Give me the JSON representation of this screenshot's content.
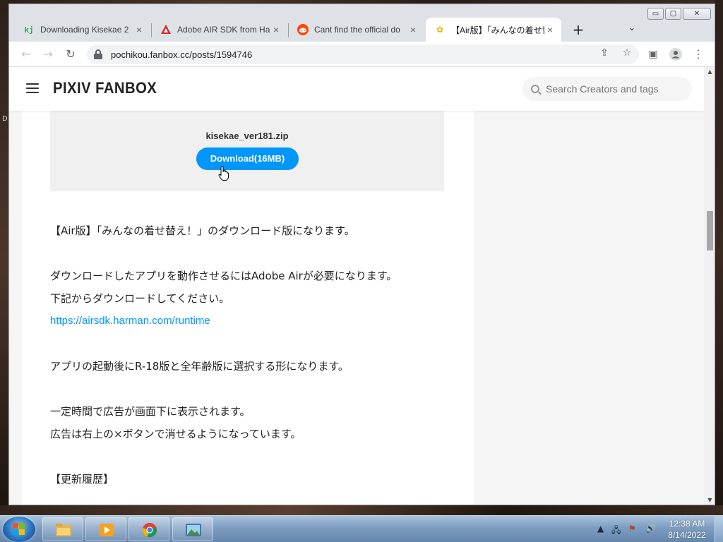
{
  "desktop": {
    "edge_char": "D"
  },
  "browser": {
    "tabs": [
      {
        "title": "Downloading Kisekae 2",
        "favicon": "kisekae-favicon",
        "color": "#3aa757"
      },
      {
        "title": "Adobe AIR SDK from Ha",
        "favicon": "adobe-air-favicon",
        "color": "#cc2b2b"
      },
      {
        "title": "Cant find the official do",
        "favicon": "reddit-favicon",
        "color": "#ff4500"
      },
      {
        "title": "【Air版】「みんなの着せ替え",
        "favicon": "fanbox-favicon",
        "color": "#f0b400",
        "active": true
      }
    ],
    "new_tab_symbol": "+",
    "url": "pochikou.fanbox.cc/posts/1594746",
    "window_controls": {
      "minimize": "▭",
      "maximize": "▢",
      "close": "✕"
    }
  },
  "site": {
    "logo": "PIXIV FANBOX",
    "search_placeholder": "Search Creators and tags"
  },
  "post": {
    "file_name": "kisekae_ver181.zip",
    "download_label": "Download(16MB)",
    "paragraphs": [
      "【Air版】「みんなの着せ替え！」のダウンロード版になります。",
      "ダウンロードしたアプリを動作させるにはAdobe Airが必要になります。",
      "下記からダウンロードしてください。",
      "https://airsdk.harman.com/runtime",
      "アプリの起動後にR-18版と全年齢版に選択する形になります。",
      "一定時間で広告が画面下に表示されます。",
      "広告は右上の×ボタンで消せるようになっています。",
      "【更新履歴】"
    ]
  },
  "taskbar": {
    "items": [
      "windows-explorer",
      "media-player",
      "google-chrome",
      "image-viewer"
    ],
    "clock_time": "12:38 AM",
    "clock_date": "8/14/2022"
  },
  "colors": {
    "accent": "#0096fa",
    "taskbar": "#7d9cc0"
  }
}
